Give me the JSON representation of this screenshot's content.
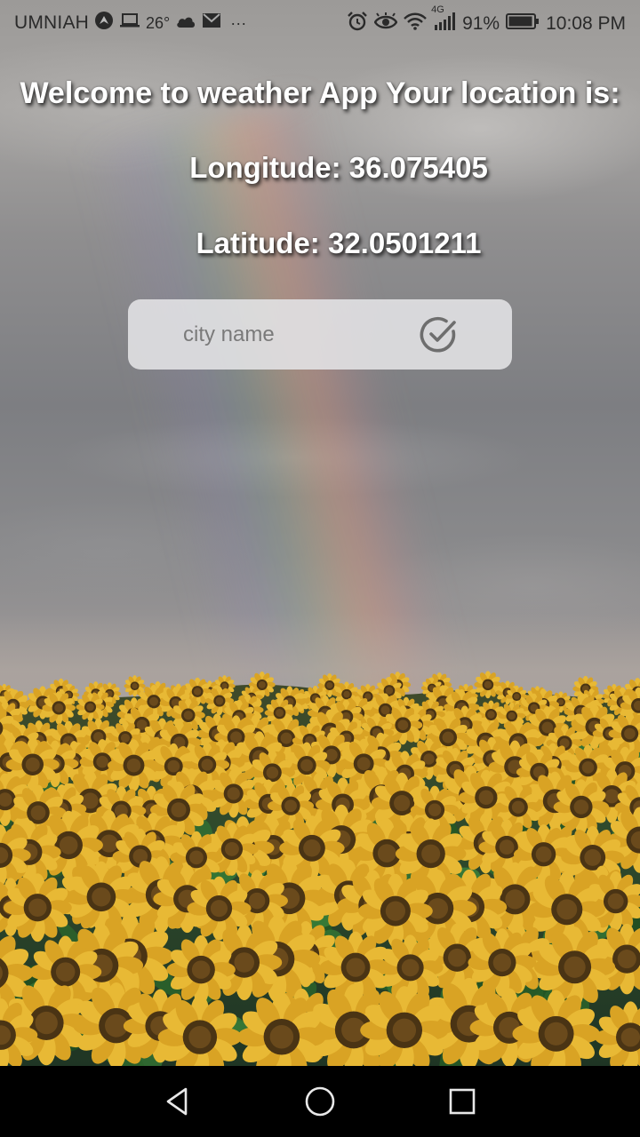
{
  "status_bar": {
    "carrier": "UMNIAH",
    "temperature": "26°",
    "network_label": "4G",
    "battery_percent": "91%",
    "time": "10:08 PM",
    "overflow_label": "···"
  },
  "content": {
    "welcome_text": "Welcome to weather App  Your location is:",
    "longitude_text": "Longitude: 36.075405",
    "latitude_text": "Latitude: 32.0501211"
  },
  "search": {
    "placeholder": "city name",
    "value": ""
  },
  "icons": {
    "submit": "check-circle-icon",
    "nav_back": "back-triangle-icon",
    "nav_home": "home-circle-icon",
    "nav_recents": "recents-square-icon"
  },
  "colors": {
    "headline_text": "#ffffff",
    "input_background": "#e4e4e6",
    "nav_bar": "#000000"
  }
}
